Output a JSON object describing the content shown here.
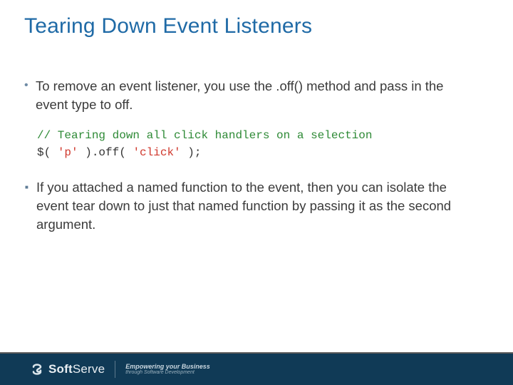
{
  "title": "Tearing Down Event Listeners",
  "bullets": {
    "b1": "To remove an event listener, you use the .off() method and pass in the event type to off.",
    "b2": "If you attached a named function to the event, then you can isolate the event tear down to just that named function by passing it as the second argument."
  },
  "code": {
    "comment": "// Tearing down all click handlers on a selection",
    "line2_a": "$( ",
    "line2_str1": "'p'",
    "line2_b": " ).off( ",
    "line2_str2": "'click'",
    "line2_c": " );"
  },
  "footer": {
    "brand_soft": "Soft",
    "brand_serve": "Serve",
    "tag1": "Empowering your Business",
    "tag2": "through Software Development"
  }
}
